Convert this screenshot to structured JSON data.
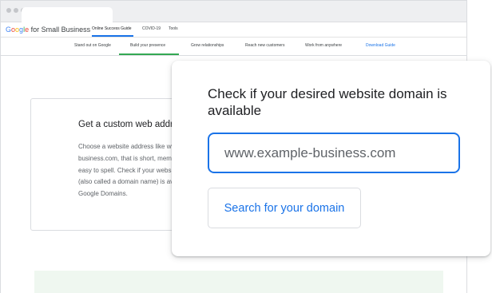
{
  "site": {
    "logo_word": "Google",
    "logo_suffix": " for Small Business",
    "logo_letters": [
      "G",
      "o",
      "o",
      "g",
      "l",
      "e"
    ]
  },
  "top_nav": [
    "Online Success Guide",
    "COVID-19",
    "Tools"
  ],
  "sub_nav": [
    "Stand out on Google",
    "Build your presence",
    "Grow relationships",
    "Reach new customers",
    "Work from anywhere",
    "Download Guide"
  ],
  "bg_card": {
    "title": "Get a custom web addre",
    "body_lines": [
      "Choose a website address like ww",
      "business.com, that is short, memo",
      "easy to spell. Check if your website",
      "(also called a domain name) is ava",
      "Google Domains."
    ]
  },
  "popup": {
    "title": "Check if your desired website domain is available",
    "input_placeholder": "www.example-business.com",
    "button_label": "Search for your domain"
  },
  "colors": {
    "accent_blue": "#1a73e8",
    "active_green": "#34a853",
    "green_panel": "#eff7f0"
  }
}
